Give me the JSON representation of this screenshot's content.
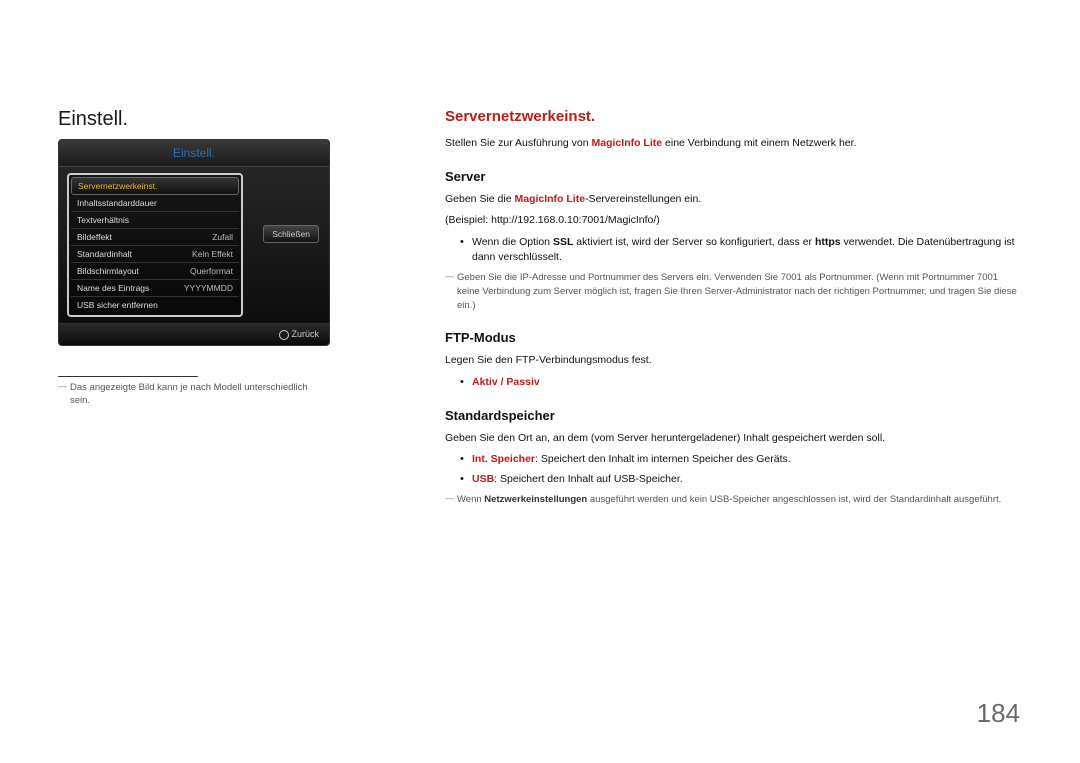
{
  "page_number": "184",
  "left": {
    "title": "Einstell.",
    "panel_header": "Einstell.",
    "menu_items": [
      {
        "label": "Servernetzwerkeinst.",
        "value": "",
        "selected": true
      },
      {
        "label": "Inhaltsstandarddauer",
        "value": ""
      },
      {
        "label": "Textverhältnis",
        "value": ""
      },
      {
        "label": "Bildeffekt",
        "value": "Zufall"
      },
      {
        "label": "Standardinhalt",
        "value": "Kein Effekt"
      },
      {
        "label": "Bildschirmlayout",
        "value": "Querformat"
      },
      {
        "label": "Name des Eintrags",
        "value": "YYYYMMDD"
      },
      {
        "label": "USB sicher entfernen",
        "value": ""
      }
    ],
    "close_button": "Schließen",
    "footer_back": "Zurück",
    "footnote": "Das angezeigte Bild kann je nach Modell unterschiedlich sein."
  },
  "right": {
    "title": "Servernetzwerkeinst.",
    "intro_pre": "Stellen Sie zur Ausführung von ",
    "intro_brand": "MagicInfo Lite",
    "intro_post": " eine Verbindung mit einem Netzwerk her.",
    "server": {
      "heading": "Server",
      "line1_pre": "Geben Sie die ",
      "line1_brand": "MagicInfo Lite",
      "line1_post": "-Servereinstellungen ein.",
      "line2": "(Beispiel: http://192.168.0.10:7001/MagicInfo/)",
      "bullet_pre": "Wenn die Option ",
      "bullet_bold": "SSL",
      "bullet_mid": " aktiviert ist, wird der Server so konfiguriert, dass er ",
      "bullet_bold2": "https",
      "bullet_post": " verwendet. Die Datenübertragung ist dann verschlüsselt.",
      "note1": "Geben Sie die IP-Adresse und Portnummer des Servers ein. Verwenden Sie 7001 als Portnummer. (Wenn mit Portnummer 7001 keine Verbindung zum Server möglich ist, fragen Sie Ihren Server-Administrator nach der richtigen Portnummer, und tragen Sie diese ein.)"
    },
    "ftp": {
      "heading": "FTP-Modus",
      "line1": "Legen Sie den FTP-Verbindungsmodus fest.",
      "options": "Aktiv / Passiv"
    },
    "storage": {
      "heading": "Standardspeicher",
      "line1": "Geben Sie den Ort an, an dem (vom Server heruntergeladener) Inhalt gespeichert werden soll.",
      "b1_bold": "Int. Speicher",
      "b1_post": ": Speichert den Inhalt im internen Speicher des Geräts.",
      "b2_bold": "USB",
      "b2_post": ": Speichert den Inhalt auf USB-Speicher.",
      "note_pre": "Wenn ",
      "note_bold": "Netzwerkeinstellungen",
      "note_post": " ausgeführt werden und kein USB-Speicher angeschlossen ist, wird der Standardinhalt ausgeführt."
    }
  }
}
